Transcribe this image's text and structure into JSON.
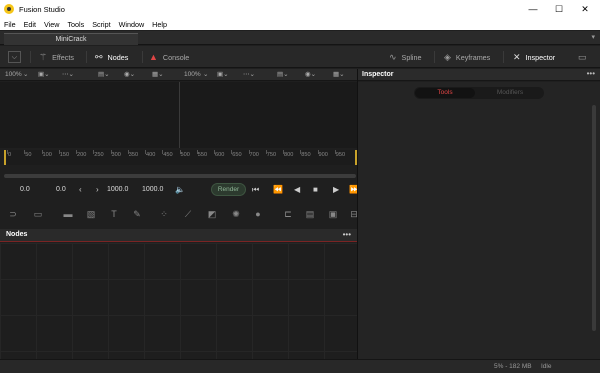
{
  "window": {
    "title": "Fusion Studio",
    "minimize": "—",
    "maximize": "☐",
    "close": "✕"
  },
  "menu": [
    "File",
    "Edit",
    "View",
    "Tools",
    "Script",
    "Window",
    "Help"
  ],
  "tab": {
    "label": "MiniCrack",
    "dropdown": "▾"
  },
  "toolbar": {
    "collapse_icon": "⌵",
    "effects": "Effects",
    "nodes": "Nodes",
    "console": "Console",
    "spline": "Spline",
    "keyframes": "Keyframes",
    "inspector": "Inspector"
  },
  "viewerbar": {
    "zoom_left": "100%",
    "zoom_right": "100%"
  },
  "ruler": {
    "ticks": [
      "0",
      "50",
      "100",
      "150",
      "200",
      "250",
      "300",
      "350",
      "400",
      "450",
      "500",
      "550",
      "600",
      "650",
      "700",
      "750",
      "800",
      "850",
      "900",
      "950"
    ]
  },
  "transport": {
    "current_time": "0.0",
    "render_start": "0.0",
    "render_end": "1000.0",
    "global_end": "1000.0",
    "render_label": "Render"
  },
  "nodes_panel": {
    "title": "Nodes",
    "menu": "•••"
  },
  "inspector": {
    "title": "Inspector",
    "menu": "•••",
    "tab_tools": "Tools",
    "tab_modifiers": "Modifiers"
  },
  "status": {
    "memory": "5% - 182 MB",
    "state": "Idle"
  },
  "colors": {
    "accent_red": "#e04545",
    "render_green": "#8fb596",
    "timeline_gold": "#c8a22a",
    "app_icon": "#f5c518"
  }
}
